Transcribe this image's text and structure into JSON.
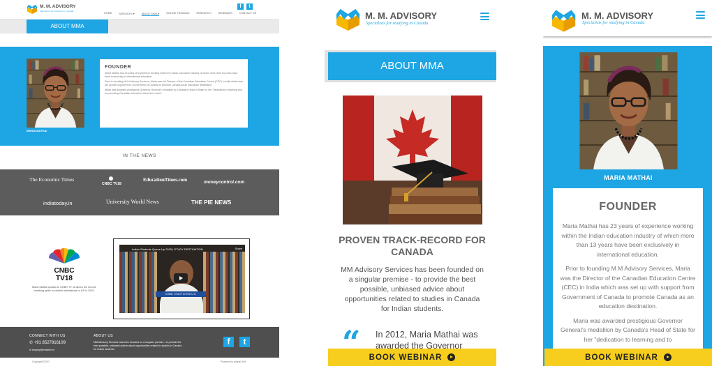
{
  "brand": {
    "name": "M. M. ADVISORY",
    "tagline": "Specialists for studying in Canada",
    "blue": "#1ea5e3",
    "yellow": "#f7ce1d"
  },
  "desktop": {
    "nav": [
      "HOME",
      "SERVICES",
      "ABOUT MMA",
      "ONLINE TRAINING",
      "RESEARCH",
      "WEBINARS",
      "CONTACT US"
    ],
    "nav_active": "ABOUT MMA",
    "about_tab": "ABOUT MMA",
    "founder": {
      "photo_caption": "MARIA MATHAI",
      "title": "FOUNDER",
      "p1": "Maria Mathai has 23 years of experience working within the Indian education industry of which more than 13 years have been exclusively in international education.",
      "p2": "Prior to founding M.M Advisory Services, Maria was the Director of the Canadian Education Centre (CEC) in India which was set up with support from Government of Canada to promote Canada as an education destination.",
      "p3": "Maria was awarded prestigious Governor General's medallion by Canada's Head of State for her \"dedication to learning and to promoting Canadian education interests in India\"."
    },
    "news_heading": "IN THE NEWS",
    "news_logos": [
      "The Economic Times",
      "CNBC TV18",
      "EducationTimes.com",
      "moneycontrol.com",
      "indiatoday.in",
      "University World News",
      "THE PIE NEWS"
    ],
    "cnbc_logo": "CNBC TV18",
    "cnbc_caption": "Maria Mathai speaks to CNBC TV 18 about the record-breaking spike in student admissions to US in 2015.",
    "video": {
      "title": "Indian Students Queue Up 2015 | STUDY DESTINATION",
      "share": "Share",
      "banner": "COME, STUDY IN THE U.S."
    },
    "footer": {
      "connect_h": "CONNECT WITH US",
      "phone": "+91 8527816109",
      "email": "enquiry@mdseen.in",
      "about_h": "ABOUT US",
      "about_text": "MM Advisory Services has been founded on a singular premise - to provide the best possible, unbiased advice about opportunities related to studies in Canada for Indian students.",
      "copyright": "Copyright©2020",
      "powered": "Powered by ananai Soft"
    }
  },
  "mobile_about": {
    "about_title": "ABOUT MMA",
    "heading": "PROVEN TRACK-RECORD FOR CANADA",
    "paragraph": "MM Advisory Services has been founded on a singular premise - to provide the best possible, unbiased advice about opportunities related to studies in Canada for Indian students.",
    "quote_text": "In 2012, Maria Mathai was awarded the Governor",
    "cta": "BOOK WEBINAR"
  },
  "mobile_founder": {
    "name": "MARIA MATHAI",
    "title": "FOUNDER",
    "p1": "Maria Mathai has 23 years of experience working within the Indian education industry of which more than 13 years have been exclusively in international education.",
    "p2": "Prior to founding M.M Advisory Services, Maria was the Director of the Canadian Education Centre (CEC) in India which was set up with support from Government of Canada to promote Canada as an education destination.",
    "p3": "Maria was awarded prestigious Governor General's medallion by Canada's Head of State for her \"dedication to learning and to",
    "cta": "BOOK WEBINAR"
  }
}
